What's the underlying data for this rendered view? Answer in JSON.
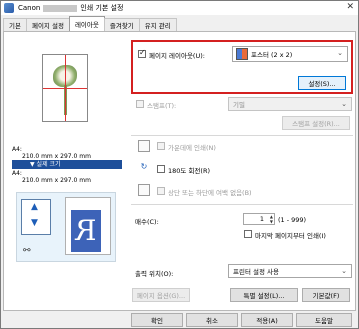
{
  "window": {
    "title_prefix": "Canon",
    "title_suffix": "인쇄 기본 설정",
    "close": "✕"
  },
  "tabs": [
    {
      "label": "기본"
    },
    {
      "label": "페이지 설정"
    },
    {
      "label": "레이아웃"
    },
    {
      "label": "즐겨찾기"
    },
    {
      "label": "유지 관리"
    }
  ],
  "paper_info": {
    "line1": "A4:",
    "line2": "210.0 mm x 297.0 mm",
    "actual_size": "실제 크기",
    "line3": "A4:",
    "line4": "210.0 mm x 297.0 mm"
  },
  "page_layout": {
    "checkbox_label": "페이지 레이아웃(U):",
    "selected": "포스터 (2 x 2)",
    "settings_button": "설정(S)..."
  },
  "stamp": {
    "label": "스탬프(T):",
    "value": "기밀",
    "button": "스탬프 설정(R)..."
  },
  "options": {
    "center": "가운데에 인쇄(N)",
    "rotate": "180도 회전(R)",
    "margins": "상단 또는 하단에 여백 없음(B)"
  },
  "copies": {
    "label": "매수(C):",
    "value": "1",
    "range": "(1 - 999)",
    "last_first": "마지막 페이지부터 인쇄(I)"
  },
  "output": {
    "label": "출력 위치(O):",
    "selected": "프린터 설정 사용"
  },
  "bottom_buttons": {
    "page_options": "페이지 옵션(G)...",
    "special": "특별 설정(L)...",
    "defaults": "기본값(F)"
  },
  "dialog_buttons": {
    "ok": "확인",
    "cancel": "취소",
    "apply": "적용(A)",
    "help": "도움말"
  },
  "icons": {
    "down_arrow": "▼",
    "up_arrow": "▲",
    "chain": "⚯",
    "check": "✓"
  }
}
